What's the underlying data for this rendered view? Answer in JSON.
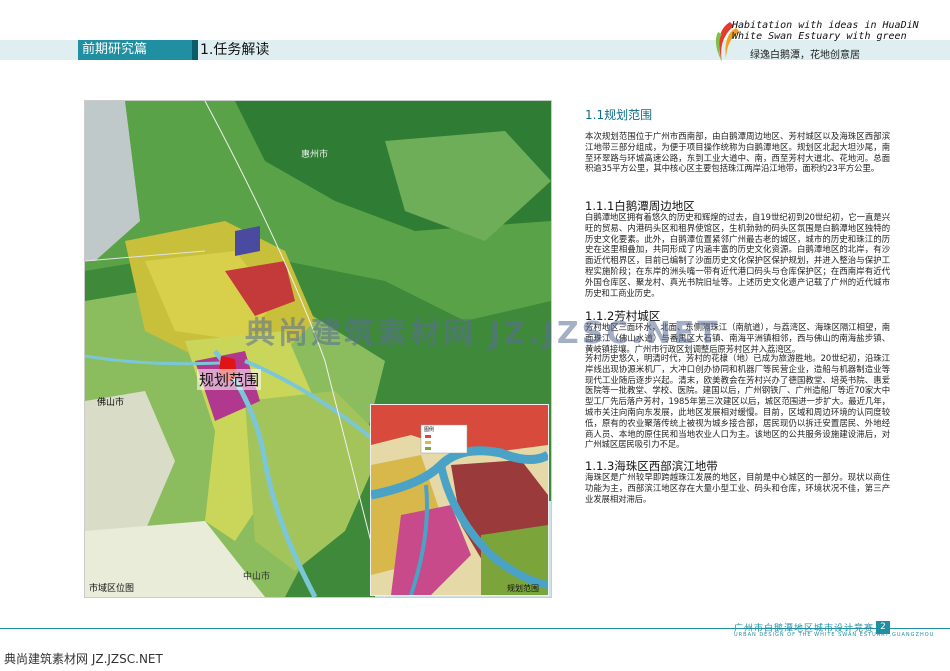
{
  "header": {
    "section_label": "前期研究篇",
    "title": "1.任务解读",
    "logo_line1": "Habitation with ideas in HuaDiN",
    "logo_line2": "White Swan Estuary with green",
    "logo_cn": "绿逸白鹅潭，花地创意居"
  },
  "map": {
    "label_planning": "规划范围",
    "label_huizhou": "惠州市",
    "label_foshan": "佛山市",
    "label_zhongshan": "中山市",
    "caption_left": "市域区位图",
    "caption_right": "规划范围",
    "inset_legend": "图例"
  },
  "content": {
    "s1_title": "1.1规划范围",
    "s1_text": "本次规划范围位于广州市西南部，由白鹅潭周边地区、芳村城区以及海珠区西部滨江地带三部分组成，为便于项目操作统称为白鹅潭地区。规划区北起大坦沙尾，南至环翠路与环城高速公路，东到工业大道中、南，西至芳村大道北、花地河。总面积逾35平方公里，其中核心区主要包括珠江两岸沿江地带，面积约23平方公里。",
    "s11_title": "1.1.1白鹅潭周边地区",
    "s11_text": "白鹅潭地区拥有着悠久的历史和辉煌的过去，自19世纪初到20世纪初，它一直是兴旺的贸易、内港码头区和租界使馆区，生机勃勃的码头区氛围是白鹅潭地区独特的历史文化要素。此外，白鹅潭位置紧邻广州最古老的城区，城市的历史和珠江的历史在这里相叠加，共同形成了内涵丰富的历史文化资源。白鹅潭地区的北岸，有沙面近代租界区，目前已编制了沙面历史文化保护区保护规划，并进入整治与保护工程实施阶段；在东岸的洲头嘴一带有近代港口码头与仓库保护区；在西南岸有近代外国仓库区、聚龙村、真光书院旧址等。上述历史文化遗产记载了广州的近代城市历史和工商业历史。",
    "s12_title": "1.1.2芳村城区",
    "s12_text_a": "芳村地区三面环水，北面、东侧隔珠江（南航道），与荔湾区、海珠区隔江相望，南面珠江（佛山水道）与番禺区大石镇、南海平洲镇相邻，西与佛山的南海盐步镇、黄岐镇接壤。广州市行政区划调整后原芳村区并入荔湾区。",
    "s12_text_b": "芳村历史悠久，明清时代，芳村的花棣（地）已成为旅游胜地。20世纪初，沿珠江岸线出现协源米机厂，大冲口创办协同和机器厂等民营企业，造船与机器制造业等现代工业随后逐步兴起。清末，欧美教会在芳村兴办了德国教堂、培英书院、惠爱医院等一批教堂、学校、医院。建国以后，广州钢铁厂、广州造船厂等近70家大中型工厂先后落户芳村，1985年第三次建区以后，城区范围进一步扩大。最近几年，城市关注向南向东发展，此地区发展相对缓慢。目前，区域和周边环境的认同度较低，原有的农业聚落传统上被视为城乡接合部，居民现仍以拆迁安置居民、外地经商人员、本地的原住民和当地农业人口为主。该地区的公共服务设施建设滞后，对广州城区居民吸引力不足。",
    "s13_title": "1.1.3海珠区西部滨江地带",
    "s13_text": "海珠区是广州较早即跨越珠江发展的地区，目前是中心城区的一部分。现状以商住功能为主，西部滨江地区存在大量小型工业、码头和仓库，环境状况不佳，第三产业发展相对滞后。"
  },
  "footer": {
    "title_cn": "广州市白鹅潭地区城市设计竞赛",
    "title_en": "URBAN DESIGN OF THE WHITE SWAN ESTUARY,GUANGZHOU",
    "page": "2",
    "bottom_watermark": "典尚建筑素材网 JZ.JZSC.NET",
    "center_watermark": "典尚建筑素材网 JZ.JZSC.NET"
  },
  "colors": {
    "accent": "#1f8fa1",
    "title_blue": "#0d6e86",
    "planning_red": "#e01414"
  }
}
